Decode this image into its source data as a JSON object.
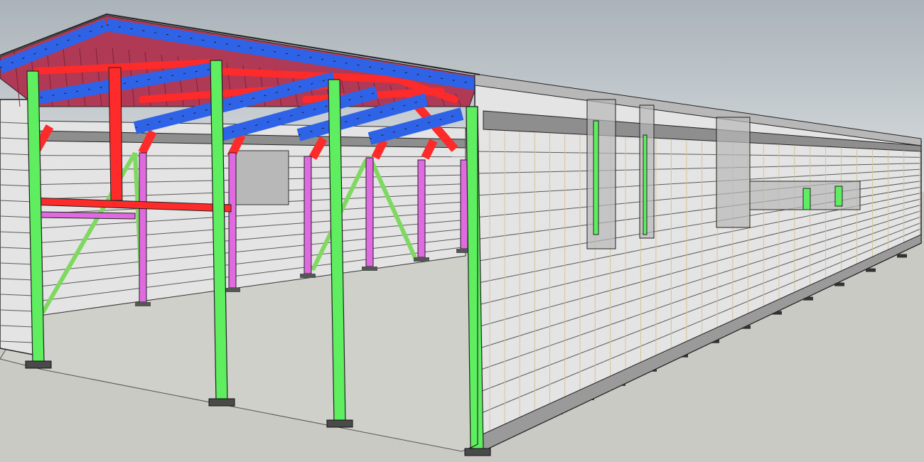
{
  "scene": {
    "subject": "",
    "colors": {
      "sky_top": "#aab3b9",
      "sky_bottom": "#dfe3e5",
      "ground": "#c9cac4",
      "floor": "#cfd0ca",
      "cladding": "#e4e4e4",
      "cladding_line": "#5a5a5a",
      "column": "#5fee5f",
      "rafter": "#2e63e8",
      "purlin": "#ff2a2a",
      "roof_sheet": "#b03a55",
      "brace": "#7fd860",
      "inner_post": "#e06be0",
      "opening": "#b8b8b8",
      "outline": "#1a1a1a"
    }
  }
}
